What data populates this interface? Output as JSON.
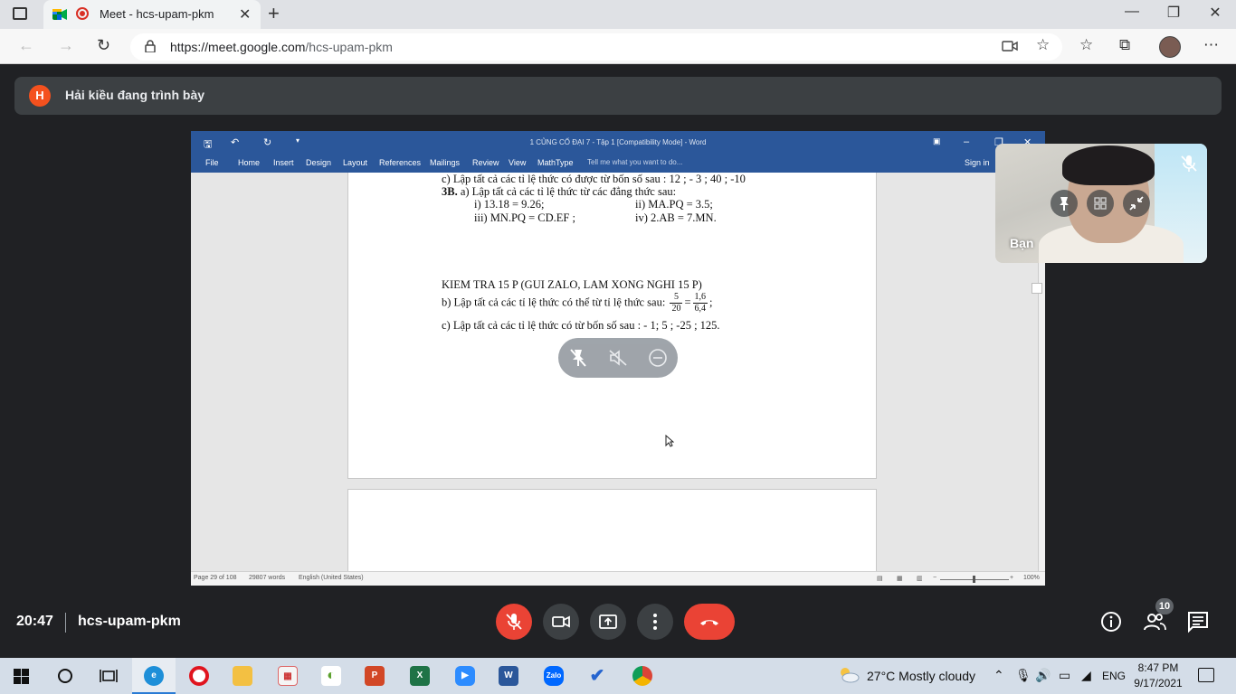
{
  "browser": {
    "tab_title": "Meet - hcs-upam-pkm",
    "url_host": "https://meet.google.com",
    "url_path": "/hcs-upam-pkm",
    "new_tab": "+",
    "close": "✕"
  },
  "meet": {
    "presenter_initial": "H",
    "presenter_text": "Hải kiều đang trình bày",
    "time": "20:47",
    "meeting_code": "hcs-upam-pkm",
    "people_count": "10",
    "self_name": "Bạn",
    "colors": {
      "end_call": "#ea4335",
      "background": "#202124",
      "presenter_avatar": "#f4511e"
    }
  },
  "word": {
    "title": "1 CỦNG CỐ ĐẠI 7 - Tập 1 [Compatibility Mode] - Word",
    "tabs": [
      "File",
      "Home",
      "Insert",
      "Design",
      "Layout",
      "References",
      "Mailings",
      "Review",
      "View",
      "MathType"
    ],
    "tell_me": "Tell me what you want to do...",
    "sign_in": "Sign in",
    "status": {
      "page": "Page 29 of 108",
      "words": "29807 words",
      "language": "English (United States)",
      "zoom": "100%"
    },
    "doc": {
      "line1": "c) Lập tất cả các tỉ lệ thức có được từ bốn số sau : 12 ; - 3 ; 40 ; -10",
      "line2_bold": "3B.",
      "line2": " a) Lập tất cả các tỉ lệ thức từ các đẳng thức sau:",
      "i": "i) 13.18 = 9.26;",
      "ii": "ii) MA.PQ = 3.5;",
      "iii": "iii) MN.PQ = CD.EF ;",
      "iv": "iv) 2.AB = 7.MN.",
      "heading": "KIEM TRA 15 P (GUI ZALO, LAM XONG NGHI 15 P)",
      "b_text": "b) Lập tất cả các tỉ lệ thức có thể từ tỉ lệ thức sau:",
      "frac1_num": "5",
      "frac1_den": "20",
      "eq": "=",
      "frac2_num": "1,6",
      "frac2_den": "6,4",
      "b_end": ";",
      "c_text": "c) Lập tất cả các tỉ lệ thức có từ bốn số sau : - 1; 5 ; -25 ; 125."
    }
  },
  "taskbar": {
    "weather": "27°C  Mostly cloudy",
    "lang": "ENG",
    "time": "8:47 PM",
    "date": "9/17/2021",
    "apps": [
      "edge",
      "opera",
      "file-explorer",
      "app-red",
      "app-green",
      "powerpoint",
      "excel",
      "zoom",
      "word",
      "zalo",
      "todo",
      "chrome"
    ]
  }
}
